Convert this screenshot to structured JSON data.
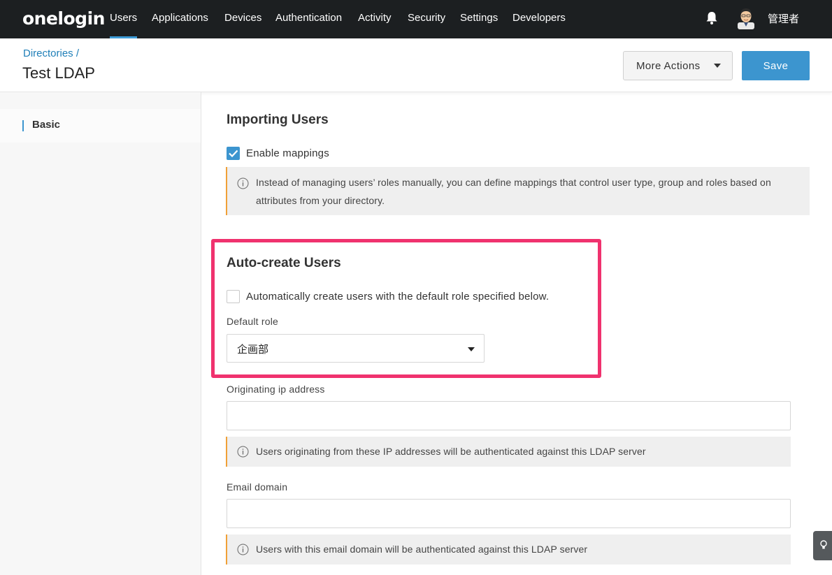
{
  "nav": {
    "logo": "onelogin",
    "items": [
      "Users",
      "Applications",
      "Devices",
      "Authentication",
      "Activity",
      "Security",
      "Settings",
      "Developers"
    ],
    "active": "Users",
    "user": "管理者"
  },
  "header": {
    "breadcrumb": "Directories /",
    "title": "Test LDAP",
    "more_actions": "More Actions",
    "save": "Save"
  },
  "sidebar": {
    "items": [
      {
        "label": "Basic",
        "active": true
      }
    ]
  },
  "importing": {
    "title": "Importing Users",
    "enable_mappings_label": "Enable mappings",
    "enable_mappings_checked": true,
    "info_line1": "Instead of managing users’ roles manually, you can define mappings that control user type, group and roles based on",
    "info_line2": "attributes from your directory."
  },
  "autocreate": {
    "title": "Auto-create Users",
    "checkbox_label": "Automatically create users with the default role specified below.",
    "checked": false,
    "default_role_label": "Default role",
    "default_role_value": "企画部"
  },
  "originating_ip": {
    "label": "Originating ip address",
    "value": "",
    "info": "Users originating from these IP addresses will be authenticated against this LDAP server"
  },
  "email_domain": {
    "label": "Email domain",
    "value": "",
    "info": "Users with this email domain will be authenticated against this LDAP server"
  },
  "colors": {
    "nav_bg": "#1c1f21",
    "accent": "#3c95cf",
    "highlight": "#f0326e",
    "info_border": "#f0a037"
  }
}
